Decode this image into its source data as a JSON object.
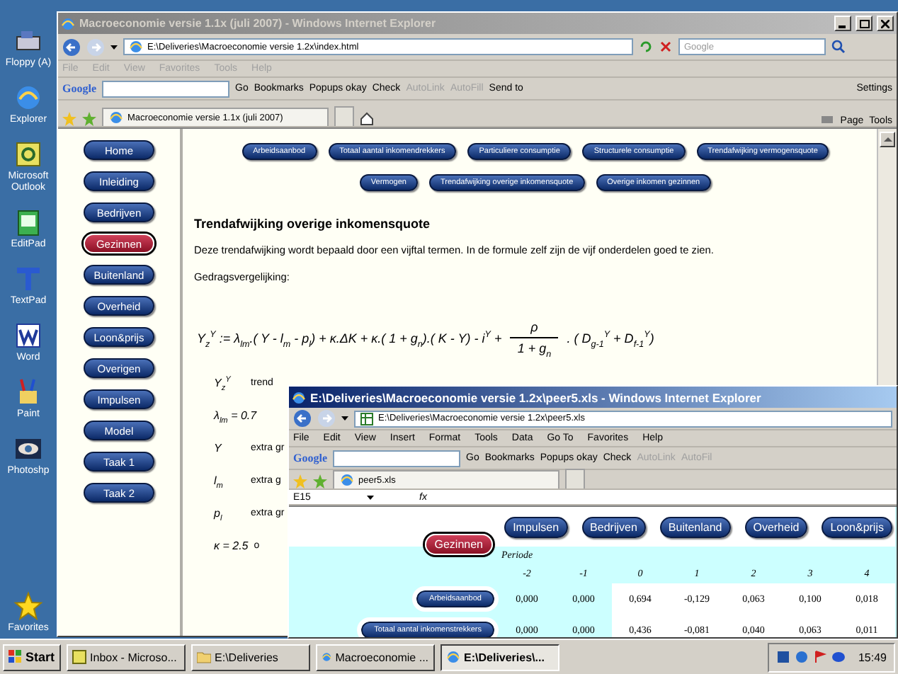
{
  "desktop_icons": [
    {
      "label": "Floppy (A)",
      "kind": "drive"
    },
    {
      "label": "Explorer",
      "kind": "browser"
    },
    {
      "label": "Microsoft Outlook",
      "kind": "mail"
    },
    {
      "label": "EditPad",
      "kind": "notepad"
    },
    {
      "label": "TextPad",
      "kind": "texteditor"
    },
    {
      "label": "Word",
      "kind": "document"
    },
    {
      "label": "Paint",
      "kind": "paint"
    },
    {
      "label": "Photoshp",
      "kind": "photo"
    },
    {
      "label": "Favorites",
      "kind": "star"
    }
  ],
  "browser_window": {
    "title": "Macroeconomie versie 1.1x (juli 2007) - Windows Internet Explorer",
    "active": false,
    "address": "E:\\Deliveries\\Macroeconomie versie 1.2x\\index.html",
    "search_placeholder": "Google",
    "menu": [
      "File",
      "Edit",
      "View",
      "Favorites",
      "Tools",
      "Help"
    ],
    "google_logo": "Google",
    "google_toolbar": [
      {
        "label": "Go",
        "disabled": false
      },
      {
        "label": "Bookmarks",
        "disabled": false
      },
      {
        "label": "Popups okay",
        "disabled": false
      },
      {
        "label": "Check",
        "disabled": false
      },
      {
        "label": "AutoLink",
        "disabled": true
      },
      {
        "label": "AutoFill",
        "disabled": true
      },
      {
        "label": "Send to",
        "disabled": false
      }
    ],
    "settings": "Settings",
    "tab": "Macroeconomie versie 1.1x (juli 2007)",
    "command_bar": [
      "Page",
      "Tools"
    ],
    "nav": [
      {
        "label": "Home",
        "selected": false
      },
      {
        "label": "Inleiding",
        "selected": false
      },
      {
        "label": "Bedrijven",
        "selected": false
      },
      {
        "label": "Gezinnen",
        "selected": true
      },
      {
        "label": "Buitenland",
        "selected": false
      },
      {
        "label": "Overheid",
        "selected": false
      },
      {
        "label": "Loon&prijs",
        "selected": false
      },
      {
        "label": "Overigen",
        "selected": false
      },
      {
        "label": "Impulsen",
        "selected": false
      },
      {
        "label": "Model",
        "selected": false
      },
      {
        "label": "Taak 1",
        "selected": false
      },
      {
        "label": "Taak 2",
        "selected": false
      }
    ],
    "subnav_rows": [
      [
        "Arbeidsaanbod",
        "Totaal aantal inkomendrekkers",
        "Particuliere consumptie",
        "Structurele consumptie",
        "Trendafwijking vermogensquote"
      ],
      [
        "Vermogen",
        "Trendafwijking overige inkomensquote",
        "Overige inkomen gezinnen"
      ]
    ],
    "heading": "Trendafwijking overige inkomensquote",
    "paragraph": "Deze trendafwijking wordt bepaald door een vijftal termen. In de formule zelf zijn de vijf onderdelen goed te zien.",
    "equation_label": "Gedragsvergelijking:",
    "formula": {
      "left": "Y$_{z}$$^{Y}$ := λ$_{lm}$.( Y - l$_{m}$ - p$_{l}$) + κ.ΔK + κ.( 1 + g$_{n}$).( K - Y) - i$^{Y}$ +",
      "numerator": "ρ",
      "denominator": "1 + g$_{n}$",
      "right": ".  ( D$_{g-1}$$^{Y}$ + D$_{f-1}$$^{Y}$)"
    },
    "variables": [
      {
        "symbol": "Y$_{z}$$^{Y}$",
        "text": "trend"
      },
      {
        "symbol": "λ$_{lm}$ = 0.7"
      },
      {
        "symbol": "Y",
        "text": "extra gr"
      },
      {
        "symbol": "l$_{m}$",
        "text": "extra g"
      },
      {
        "symbol": "p$_{l}$",
        "text": "extra gr"
      },
      {
        "symbol": "κ = 2.5",
        "text": "o"
      }
    ]
  },
  "sheet_window": {
    "title": "E:\\Deliveries\\Macroeconomie versie 1.2x\\peer5.xls - Windows Internet Explorer",
    "active": true,
    "address": "E:\\Deliveries\\Macroeconomie versie 1.2x\\peer5.xls",
    "menu": [
      "File",
      "Edit",
      "View",
      "Insert",
      "Format",
      "Tools",
      "Data",
      "Go To",
      "Favorites",
      "Help"
    ],
    "google_logo": "Google",
    "google_toolbar": [
      {
        "label": "Go",
        "disabled": false
      },
      {
        "label": "Bookmarks",
        "disabled": false
      },
      {
        "label": "Popups okay",
        "disabled": false
      },
      {
        "label": "Check",
        "disabled": false
      },
      {
        "label": "AutoLink",
        "disabled": true
      },
      {
        "label": "AutoFil",
        "disabled": true
      }
    ],
    "tab": "peer5.xls",
    "name_box": "E15",
    "formula_label": "fx",
    "buttons": [
      {
        "label": "Impulsen",
        "selected": false
      },
      {
        "label": "Bedrijven",
        "selected": false
      },
      {
        "label": "Buitenland",
        "selected": false
      },
      {
        "label": "Overheid",
        "selected": false
      },
      {
        "label": "Loon&prijs",
        "selected": false
      }
    ],
    "current": {
      "label": "Gezinnen",
      "selected": true
    },
    "periode_label": "Periode",
    "periods": [
      "-2",
      "-1",
      "0",
      "1",
      "2",
      "3",
      "4"
    ],
    "rows": [
      {
        "label": "Arbeidsaanbod",
        "values": [
          "0,000",
          "0,000",
          "0,694",
          "-0,129",
          "0,063",
          "0,100",
          "0,018"
        ]
      },
      {
        "label": "Totaal aantal inkomenstrekkers",
        "values": [
          "0,000",
          "0,000",
          "0,436",
          "-0,081",
          "0,040",
          "0,063",
          "0,011"
        ]
      }
    ]
  },
  "taskbar": {
    "start": "Start",
    "items": [
      {
        "label": "Inbox - Microso...",
        "kind": "mail",
        "selected": false
      },
      {
        "label": "E:\\Deliveries",
        "kind": "folder",
        "selected": false
      },
      {
        "label": "Macroeconomie ...",
        "kind": "browser",
        "selected": false
      },
      {
        "label": "E:\\Deliveries\\...",
        "kind": "browser",
        "selected": true
      }
    ],
    "clock": "15:49"
  }
}
